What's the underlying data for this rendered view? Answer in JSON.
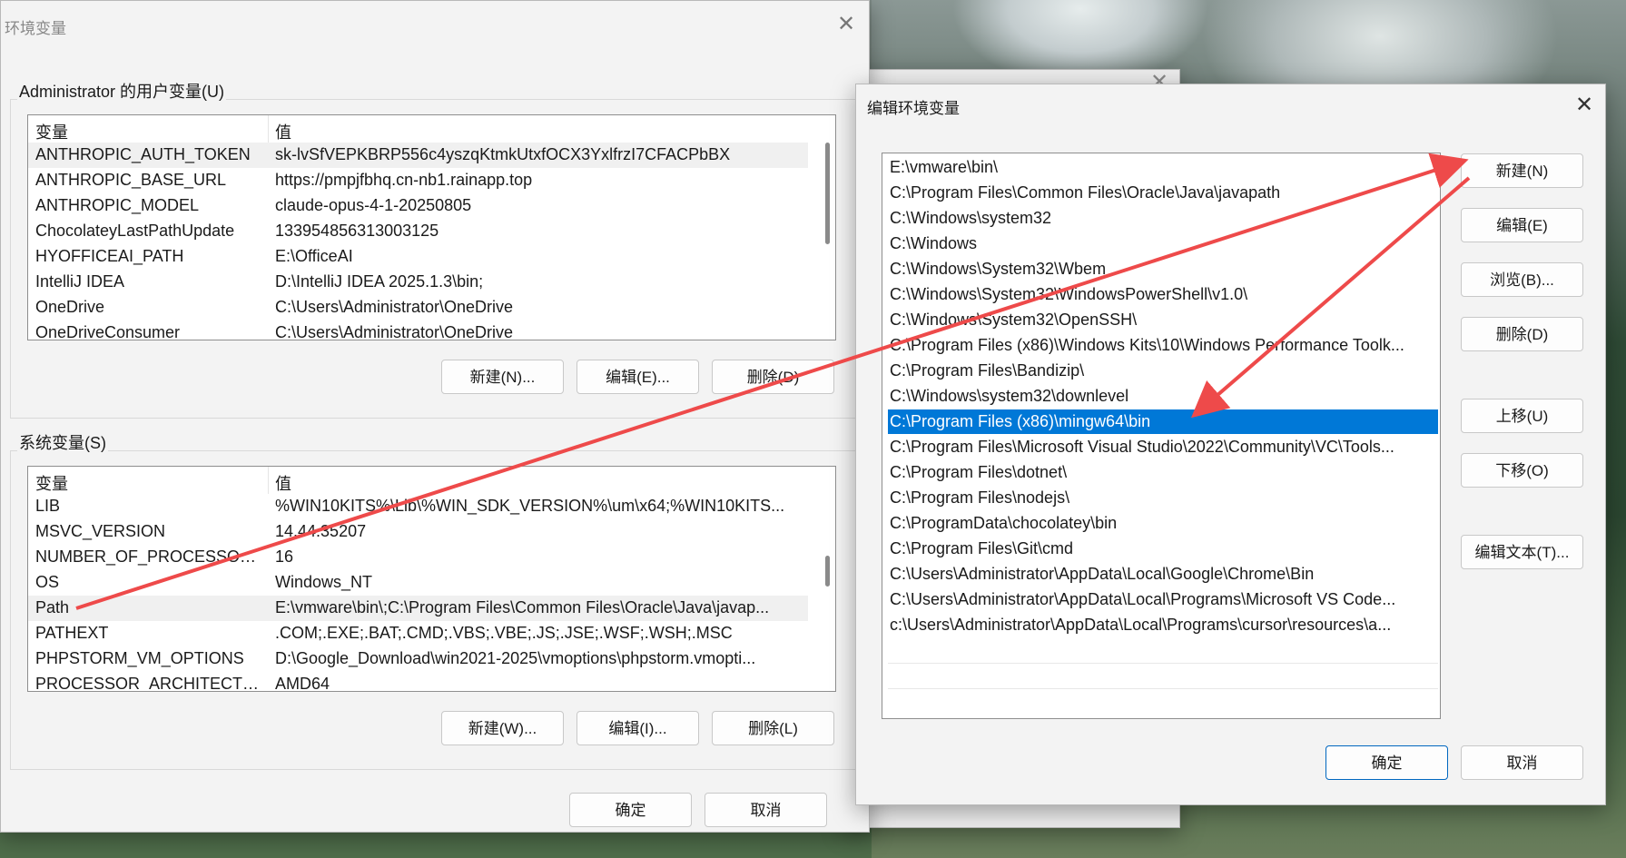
{
  "colors": {
    "arrow": "#ee4a4a",
    "selection": "#0078d7",
    "primary_border": "#0067c0"
  },
  "env_dialog": {
    "title": "环境变量",
    "user_section": {
      "label": "Administrator 的用户变量(U)",
      "header": {
        "name": "变量",
        "value": "值"
      },
      "rows": [
        {
          "name": "ANTHROPIC_AUTH_TOKEN",
          "value": "sk-lvSfVEPKBRP556c4yszqKtmkUtxfOCX3YxlfrzI7CFACPbBX"
        },
        {
          "name": "ANTHROPIC_BASE_URL",
          "value": "https://pmpjfbhq.cn-nb1.rainapp.top"
        },
        {
          "name": "ANTHROPIC_MODEL",
          "value": "claude-opus-4-1-20250805"
        },
        {
          "name": "ChocolateyLastPathUpdate",
          "value": "133954856313003125"
        },
        {
          "name": "HYOFFICEAI_PATH",
          "value": "E:\\OfficeAI"
        },
        {
          "name": "IntelliJ IDEA",
          "value": "D:\\IntelliJ IDEA 2025.1.3\\bin;"
        },
        {
          "name": "OneDrive",
          "value": "C:\\Users\\Administrator\\OneDrive"
        },
        {
          "name": "OneDriveConsumer",
          "value": "C:\\Users\\Administrator\\OneDrive"
        }
      ],
      "buttons": {
        "new": "新建(N)...",
        "edit": "编辑(E)...",
        "delete": "删除(D)"
      }
    },
    "system_section": {
      "label": "系统变量(S)",
      "header": {
        "name": "变量",
        "value": "值"
      },
      "rows": [
        {
          "name": "LIB",
          "value": "%WIN10KITS%\\Lib\\%WIN_SDK_VERSION%\\um\\x64;%WIN10KITS..."
        },
        {
          "name": "MSVC_VERSION",
          "value": "14.44.35207"
        },
        {
          "name": "NUMBER_OF_PROCESSORS",
          "value": "16"
        },
        {
          "name": "OS",
          "value": "Windows_NT"
        },
        {
          "name": "Path",
          "value": "E:\\vmware\\bin\\;C:\\Program Files\\Common Files\\Oracle\\Java\\javap..."
        },
        {
          "name": "PATHEXT",
          "value": ".COM;.EXE;.BAT;.CMD;.VBS;.VBE;.JS;.JSE;.WSF;.WSH;.MSC"
        },
        {
          "name": "PHPSTORM_VM_OPTIONS",
          "value": "D:\\Google_Download\\win2021-2025\\vmoptions\\phpstorm.vmopti..."
        },
        {
          "name": "PROCESSOR_ARCHITECTURE",
          "value": "AMD64"
        }
      ],
      "buttons": {
        "new": "新建(W)...",
        "edit": "编辑(I)...",
        "delete": "删除(L)"
      }
    },
    "ok": "确定",
    "cancel": "取消"
  },
  "edit_dialog": {
    "title": "编辑环境变量",
    "items": [
      "E:\\vmware\\bin\\",
      "C:\\Program Files\\Common Files\\Oracle\\Java\\javapath",
      "C:\\Windows\\system32",
      "C:\\Windows",
      "C:\\Windows\\System32\\Wbem",
      "C:\\Windows\\System32\\WindowsPowerShell\\v1.0\\",
      "C:\\Windows\\System32\\OpenSSH\\",
      "C:\\Program Files (x86)\\Windows Kits\\10\\Windows Performance Toolk...",
      "C:\\Program Files\\Bandizip\\",
      "C:\\Windows\\system32\\downlevel",
      "C:\\Program Files (x86)\\mingw64\\bin",
      "C:\\Program Files\\Microsoft Visual Studio\\2022\\Community\\VC\\Tools...",
      "C:\\Program Files\\dotnet\\",
      "C:\\Program Files\\nodejs\\",
      "C:\\ProgramData\\chocolatey\\bin",
      "C:\\Program Files\\Git\\cmd",
      "C:\\Users\\Administrator\\AppData\\Local\\Google\\Chrome\\Bin",
      "C:\\Users\\Administrator\\AppData\\Local\\Programs\\Microsoft VS Code...",
      "c:\\Users\\Administrator\\AppData\\Local\\Programs\\cursor\\resources\\a..."
    ],
    "selected_index": 10,
    "buttons": {
      "new": "新建(N)",
      "edit": "编辑(E)",
      "browse": "浏览(B)...",
      "delete": "删除(D)",
      "move_up": "上移(U)",
      "move_down": "下移(O)",
      "edit_text": "编辑文本(T)..."
    },
    "ok": "确定",
    "cancel": "取消"
  }
}
